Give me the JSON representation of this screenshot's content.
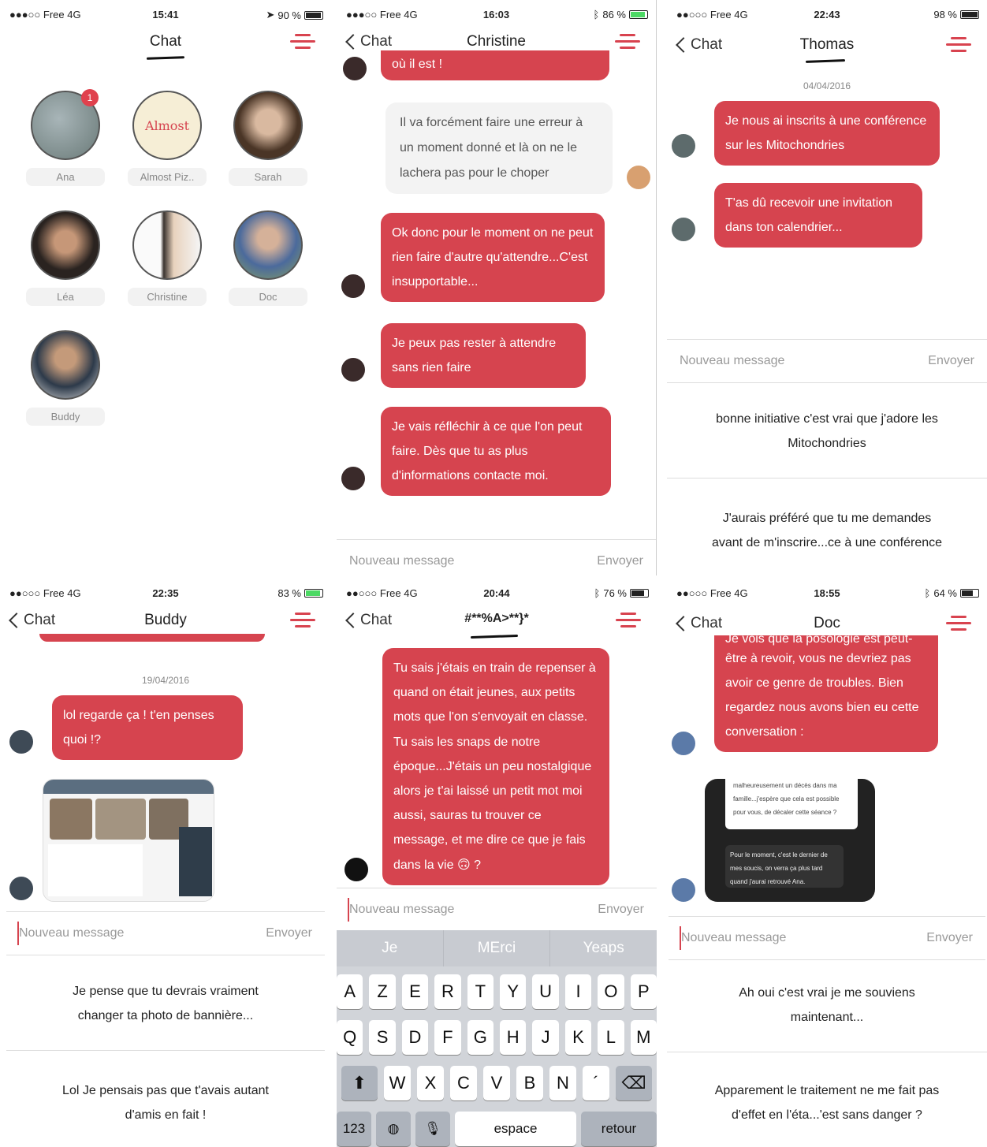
{
  "colors": {
    "accent": "#d6444f",
    "badge": "#e0414d"
  },
  "icons": {
    "menu": "hamburger-menu-icon",
    "back": "chevron-left-icon"
  },
  "p1": {
    "status": {
      "left": "●●●○○ Free  4G",
      "time": "15:41",
      "right": "90 %"
    },
    "title": "Chat",
    "contacts": [
      {
        "name": "Ana",
        "badge": "1"
      },
      {
        "name": "Almost Piz..",
        "logo": "Almost"
      },
      {
        "name": "Sarah"
      },
      {
        "name": "Léa"
      },
      {
        "name": "Christine"
      },
      {
        "name": "Doc"
      },
      {
        "name": "Buddy"
      }
    ]
  },
  "p2": {
    "status": {
      "left": "●●●○○ Free  4G",
      "time": "16:03",
      "right": "86 %"
    },
    "back": "Chat",
    "title": "Christine",
    "top_fragment": "où il est !",
    "grey_message": "Il va forcément faire une erreur à un moment donné et là on ne le lachera pas pour le choper",
    "messages": [
      "Ok donc pour le moment on ne peut rien faire d'autre qu'attendre...C'est insupportable...",
      "Je peux pas rester à attendre sans rien faire",
      "Je vais réfléchir à ce que l'on peut faire. Dès que tu as plus d'informations contacte moi."
    ],
    "placeholder": "Nouveau message",
    "send": "Envoyer"
  },
  "p3": {
    "status": {
      "left": "●●○○○ Free  4G",
      "time": "22:43",
      "right": "98 %"
    },
    "back": "Chat",
    "title": "Thomas",
    "date": "04/04/2016",
    "messages": [
      "Je nous ai inscrits à une conférence sur les Mitochondries",
      "T'as dû recevoir une invitation dans ton calendrier..."
    ],
    "placeholder": "Nouveau message",
    "send": "Envoyer",
    "suggestions": [
      "bonne initiative c'est vrai que j'adore les Mitochondries",
      "J'aurais préféré que tu me demandes avant de m'inscrire...ce à une conférence"
    ]
  },
  "p4": {
    "status": {
      "left": "●●○○○ Free  4G",
      "time": "22:35",
      "right": "83 %"
    },
    "back": "Chat",
    "title": "Buddy",
    "date": "19/04/2016",
    "message": "lol regarde ça ! t'en penses quoi !?",
    "placeholder": "Nouveau message",
    "send": "Envoyer",
    "suggestions": [
      "Je pense que tu devrais vraiment changer ta photo de bannière...",
      "Lol Je pensais pas que t'avais autant d'amis en fait !"
    ]
  },
  "p5": {
    "status": {
      "left": "●●○○○ Free  4G",
      "time": "20:44",
      "right": "76 %"
    },
    "back": "Chat",
    "title": "#**%A>**}*",
    "message": "Tu sais j'étais en train de repenser à quand on était jeunes, aux petits mots que l'on s'envoyait en classe. Tu sais les snaps de notre époque...J'étais un peu nostalgique alors je t'ai laissé un petit mot moi aussi, sauras tu trouver ce message, et me dire ce que je fais dans la vie 🙃 ?",
    "placeholder": "Nouveau message",
    "send": "Envoyer",
    "keyboard": {
      "suggestions": [
        "Je",
        "MErci",
        "Yeaps"
      ],
      "row1": [
        "A",
        "Z",
        "E",
        "R",
        "T",
        "Y",
        "U",
        "I",
        "O",
        "P"
      ],
      "row2": [
        "Q",
        "S",
        "D",
        "F",
        "G",
        "H",
        "J",
        "K",
        "L",
        "M"
      ],
      "row3": [
        "W",
        "X",
        "C",
        "V",
        "B",
        "N",
        "´"
      ],
      "num": "123",
      "space": "espace",
      "return": "retour"
    }
  },
  "p6": {
    "status": {
      "left": "●●○○○ Free  4G",
      "time": "18:55",
      "right": "64 %"
    },
    "back": "Chat",
    "title": "Doc",
    "top_fragment": "Je vois que la posologie est peut-",
    "message": "être à revoir, vous ne devriez pas avoir ce genre de troubles. Bien regardez nous avons bien eu cette conversation :",
    "quoted_white": "malheureusement un décès dans ma famille...j'espère que cela est possible pour vous, de décaler cette séance ?",
    "quoted_dark": "Pour le moment, c'est le dernier de mes soucis, on verra ça plus tard quand j'aurai retrouvé Ana.",
    "placeholder": "Nouveau message",
    "send": "Envoyer",
    "suggestions": [
      "Ah oui c'est vrai je me souviens maintenant...",
      "Apparement le traitement ne me fait pas d'effet en l'éta...'est sans danger ?"
    ]
  }
}
